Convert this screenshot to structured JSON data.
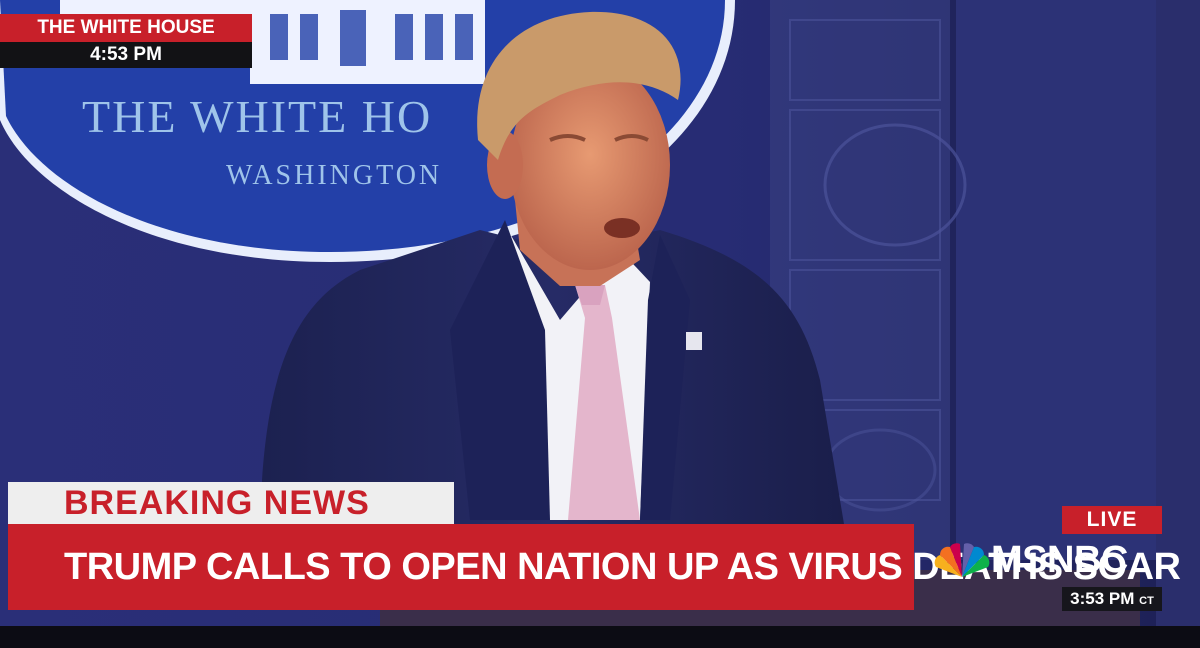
{
  "location_bug": {
    "place": "THE WHITE HOUSE",
    "time": "4:53 PM"
  },
  "backdrop": {
    "seal_main": "THE WHITE HO",
    "seal_sub": "WASHINGTON"
  },
  "lower_third": {
    "banner": "BREAKING NEWS",
    "headline": "TRUMP CALLS TO OPEN NATION UP AS VIRUS DEATHS SOAR"
  },
  "network": {
    "logo_icon": "peacock-icon",
    "name": "MSNBC",
    "live_label": "LIVE",
    "clock_time": "3:53 PM",
    "clock_zone": "CT"
  },
  "colors": {
    "accent_red": "#c8202a",
    "backdrop_blue": "#1f2a7a",
    "banner_white": "#eeeeee"
  }
}
